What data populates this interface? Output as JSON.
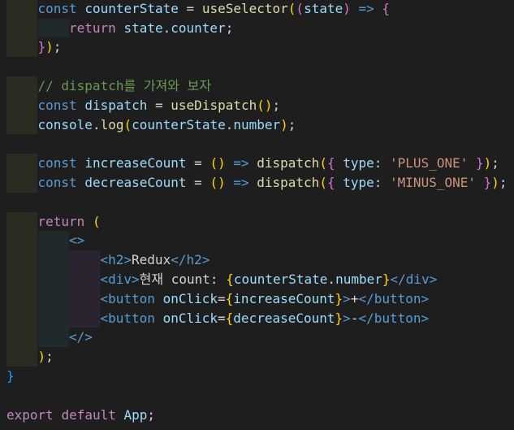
{
  "code": {
    "lines": [
      {
        "indent": 1,
        "tokens": [
          {
            "t": "const",
            "c": "const"
          },
          {
            "t": " ",
            "c": "plain"
          },
          {
            "t": "counterState",
            "c": "var"
          },
          {
            "t": " = ",
            "c": "op"
          },
          {
            "t": "useSelector",
            "c": "fn"
          },
          {
            "t": "(",
            "c": "br1"
          },
          {
            "t": "(",
            "c": "br2"
          },
          {
            "t": "state",
            "c": "var"
          },
          {
            "t": ")",
            "c": "br2"
          },
          {
            "t": " => ",
            "c": "const"
          },
          {
            "t": "{",
            "c": "br2"
          }
        ]
      },
      {
        "indent": 2,
        "tokens": [
          {
            "t": "return",
            "c": "kw"
          },
          {
            "t": " ",
            "c": "plain"
          },
          {
            "t": "state",
            "c": "var"
          },
          {
            "t": ".",
            "c": "punc"
          },
          {
            "t": "counter",
            "c": "prop"
          },
          {
            "t": ";",
            "c": "punc"
          }
        ]
      },
      {
        "indent": 1,
        "tokens": [
          {
            "t": "}",
            "c": "br2"
          },
          {
            "t": ")",
            "c": "br1"
          },
          {
            "t": ";",
            "c": "punc"
          }
        ]
      },
      {
        "indent": 0,
        "tokens": []
      },
      {
        "indent": 1,
        "tokens": [
          {
            "t": "// dispatch를 가져와 보자",
            "c": "cmt"
          }
        ]
      },
      {
        "indent": 1,
        "tokens": [
          {
            "t": "const",
            "c": "const"
          },
          {
            "t": " ",
            "c": "plain"
          },
          {
            "t": "dispatch",
            "c": "var"
          },
          {
            "t": " = ",
            "c": "op"
          },
          {
            "t": "useDispatch",
            "c": "fn"
          },
          {
            "t": "()",
            "c": "br1"
          },
          {
            "t": ";",
            "c": "punc"
          }
        ]
      },
      {
        "indent": 1,
        "tokens": [
          {
            "t": "console",
            "c": "var"
          },
          {
            "t": ".",
            "c": "punc"
          },
          {
            "t": "log",
            "c": "fn"
          },
          {
            "t": "(",
            "c": "br1"
          },
          {
            "t": "counterState",
            "c": "var"
          },
          {
            "t": ".",
            "c": "punc"
          },
          {
            "t": "number",
            "c": "prop"
          },
          {
            "t": ")",
            "c": "br1"
          },
          {
            "t": ";",
            "c": "punc"
          }
        ]
      },
      {
        "indent": 0,
        "tokens": []
      },
      {
        "indent": 1,
        "tokens": [
          {
            "t": "const",
            "c": "const"
          },
          {
            "t": " ",
            "c": "plain"
          },
          {
            "t": "increaseCount",
            "c": "var"
          },
          {
            "t": " = ",
            "c": "op"
          },
          {
            "t": "()",
            "c": "br1"
          },
          {
            "t": " => ",
            "c": "const"
          },
          {
            "t": "dispatch",
            "c": "fn"
          },
          {
            "t": "(",
            "c": "br1"
          },
          {
            "t": "{",
            "c": "br2"
          },
          {
            "t": " type: ",
            "c": "prop"
          },
          {
            "t": "'PLUS_ONE'",
            "c": "str"
          },
          {
            "t": " ",
            "c": "plain"
          },
          {
            "t": "}",
            "c": "br2"
          },
          {
            "t": ")",
            "c": "br1"
          },
          {
            "t": ";",
            "c": "punc"
          }
        ]
      },
      {
        "indent": 1,
        "tokens": [
          {
            "t": "const",
            "c": "const"
          },
          {
            "t": " ",
            "c": "plain"
          },
          {
            "t": "decreaseCount",
            "c": "var"
          },
          {
            "t": " = ",
            "c": "op"
          },
          {
            "t": "()",
            "c": "br1"
          },
          {
            "t": " => ",
            "c": "const"
          },
          {
            "t": "dispatch",
            "c": "fn"
          },
          {
            "t": "(",
            "c": "br1"
          },
          {
            "t": "{",
            "c": "br2"
          },
          {
            "t": " type: ",
            "c": "prop"
          },
          {
            "t": "'MINUS_ONE'",
            "c": "str"
          },
          {
            "t": " ",
            "c": "plain"
          },
          {
            "t": "}",
            "c": "br2"
          },
          {
            "t": ")",
            "c": "br1"
          },
          {
            "t": ";",
            "c": "punc"
          }
        ]
      },
      {
        "indent": 0,
        "tokens": []
      },
      {
        "indent": 1,
        "tokens": [
          {
            "t": "return",
            "c": "kw"
          },
          {
            "t": " ",
            "c": "plain"
          },
          {
            "t": "(",
            "c": "br1"
          }
        ]
      },
      {
        "indent": 2,
        "tokens": [
          {
            "t": "<>",
            "c": "tag"
          }
        ]
      },
      {
        "indent": 3,
        "tokens": [
          {
            "t": "<h2>",
            "c": "tag"
          },
          {
            "t": "Redux",
            "c": "text"
          },
          {
            "t": "</h2>",
            "c": "tag"
          }
        ]
      },
      {
        "indent": 3,
        "tokens": [
          {
            "t": "<div>",
            "c": "tag"
          },
          {
            "t": "현재 count: ",
            "c": "text"
          },
          {
            "t": "{",
            "c": "br1"
          },
          {
            "t": "counterState",
            "c": "var"
          },
          {
            "t": ".",
            "c": "punc"
          },
          {
            "t": "number",
            "c": "prop"
          },
          {
            "t": "}",
            "c": "br1"
          },
          {
            "t": "</div>",
            "c": "tag"
          }
        ]
      },
      {
        "indent": 3,
        "tokens": [
          {
            "t": "<button",
            "c": "tag"
          },
          {
            "t": " ",
            "c": "plain"
          },
          {
            "t": "onClick",
            "c": "attr"
          },
          {
            "t": "=",
            "c": "op"
          },
          {
            "t": "{",
            "c": "br1"
          },
          {
            "t": "increaseCount",
            "c": "var"
          },
          {
            "t": "}",
            "c": "br1"
          },
          {
            "t": ">",
            "c": "tag"
          },
          {
            "t": "+",
            "c": "text"
          },
          {
            "t": "</button>",
            "c": "tag"
          }
        ]
      },
      {
        "indent": 3,
        "tokens": [
          {
            "t": "<button",
            "c": "tag"
          },
          {
            "t": " ",
            "c": "plain"
          },
          {
            "t": "onClick",
            "c": "attr"
          },
          {
            "t": "=",
            "c": "op"
          },
          {
            "t": "{",
            "c": "br1"
          },
          {
            "t": "decreaseCount",
            "c": "var"
          },
          {
            "t": "}",
            "c": "br1"
          },
          {
            "t": ">",
            "c": "tag"
          },
          {
            "t": "-",
            "c": "text"
          },
          {
            "t": "</button>",
            "c": "tag"
          }
        ]
      },
      {
        "indent": 2,
        "tokens": [
          {
            "t": "</>",
            "c": "tag"
          }
        ]
      },
      {
        "indent": 1,
        "tokens": [
          {
            "t": ")",
            "c": "br1"
          },
          {
            "t": ";",
            "c": "punc"
          }
        ]
      },
      {
        "indent": 0,
        "tokens": [
          {
            "t": "}",
            "c": "br3"
          }
        ]
      },
      {
        "indent": 0,
        "tokens": []
      },
      {
        "indent": 0,
        "tokens": [
          {
            "t": "export",
            "c": "kw"
          },
          {
            "t": " ",
            "c": "plain"
          },
          {
            "t": "default",
            "c": "kw"
          },
          {
            "t": " ",
            "c": "plain"
          },
          {
            "t": "App",
            "c": "var"
          },
          {
            "t": ";",
            "c": "punc"
          }
        ]
      }
    ]
  }
}
